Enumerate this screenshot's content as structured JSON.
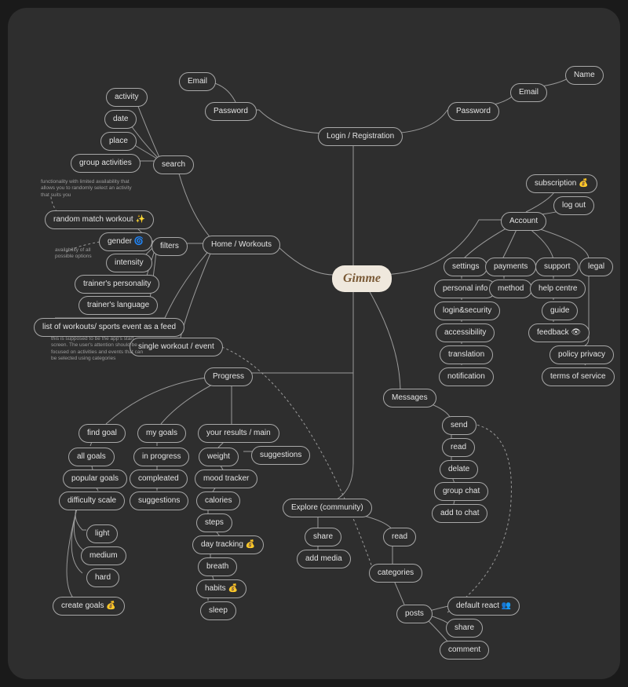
{
  "logo": "Gimme",
  "login": {
    "root": "Login / Registration",
    "left": {
      "password": "Password",
      "email": "Email"
    },
    "right": {
      "password": "Password",
      "email": "Email",
      "name": "Name"
    }
  },
  "home": {
    "root": "Home / Workouts",
    "search": {
      "root": "search",
      "activity": "activity",
      "date": "date",
      "place": "place",
      "group": "group activities"
    },
    "filters": {
      "root": "filters",
      "random": "random match workout ✨",
      "gender": "gender 🌀",
      "intensity": "intensity",
      "personality": "trainer's personality",
      "language": "trainer's language"
    },
    "feed": "list of workouts/ sports event as a feed",
    "single": "single workout / event",
    "note_random": "functionality with limited availability that allows you to randomly select an activity that suits you",
    "note_gender": "availability of all possible options",
    "note_feed": "this is supposed to be the app's start screen. The user's attention should be focused on activities and events that can be selected using categories"
  },
  "account": {
    "root": "Account",
    "subscription": "subscription 💰",
    "logout": "log out",
    "settings": {
      "root": "settings",
      "personal": "personal info",
      "login": "login&security",
      "access": "accessibility",
      "trans": "translation",
      "notif": "notification"
    },
    "payments": {
      "root": "payments",
      "method": "method"
    },
    "support": {
      "root": "support",
      "help": "help centre",
      "guide": "guide",
      "feedback": "feedback 👁"
    },
    "legal": {
      "root": "legal",
      "privacy": "policy privacy",
      "tos": "terms of service"
    }
  },
  "progress": {
    "root": "Progress",
    "find": {
      "root": "find goal",
      "all": "all goals",
      "popular": "popular goals",
      "difficulty": "difficulty scale"
    },
    "diff": {
      "light": "light",
      "medium": "medium",
      "hard": "hard"
    },
    "create": "create goals 💰",
    "mygoals": {
      "root": "my goals",
      "inprog": "in progress",
      "completed": "compleated",
      "sugg": "suggestions"
    },
    "results": {
      "root": "your results / main",
      "weight": "weight",
      "sugg": "suggestions",
      "mood": "mood tracker",
      "cal": "calories",
      "steps": "steps",
      "day": "day tracking 💰",
      "breath": "breath",
      "habits": "habits 💰",
      "sleep": "sleep"
    }
  },
  "messages": {
    "root": "Messages",
    "send": "send",
    "read": "read",
    "delete": "delate",
    "group": "group chat",
    "add": "add to chat"
  },
  "explore": {
    "root": "Explore (community)",
    "share": "share",
    "addmedia": "add media",
    "read": "read",
    "categories": "categories",
    "posts": {
      "root": "posts",
      "react": "default react 👥",
      "share": "share",
      "comment": "comment"
    }
  }
}
